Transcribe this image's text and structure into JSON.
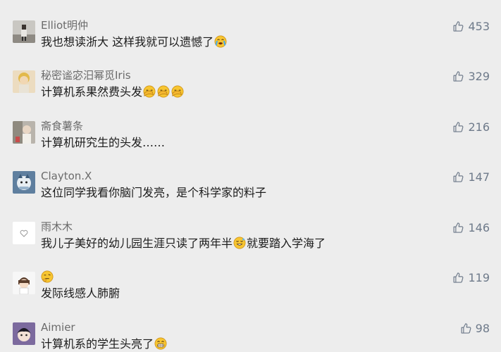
{
  "comments": [
    {
      "name": "Elliot明仲",
      "text": "我也想读浙大 这样我就可以遗憾了",
      "likes": "453"
    },
    {
      "name": "秘密谧宓汨幂觅Iris",
      "text": "计算机系果然费头发",
      "likes": "329"
    },
    {
      "name": "斋食薯条",
      "text": "计算机研究生的头发……",
      "likes": "216"
    },
    {
      "name": "Clayton.X",
      "text": "这位同学我看你脑门发亮，是个科学家的料子",
      "likes": "147"
    },
    {
      "name": "雨木木",
      "text": "我儿子美好的幼儿园生涯只读了两年半",
      "text2": "就要踏入学海了",
      "likes": "146"
    },
    {
      "name": "",
      "text": "发际线感人肺腑",
      "likes": "119"
    },
    {
      "name": "Aimier",
      "text": "计算机系的学生头亮了",
      "likes": "98"
    }
  ],
  "icons": {
    "like": "thumbs-up-icon",
    "crying": "loudly-crying-emoji",
    "facepalm": "facepalm-emoji",
    "awkward": "awkward-smile-emoji",
    "thinking": "thinking-emoji",
    "grin": "grin-emoji"
  },
  "colors": {
    "background": "#ededed",
    "name": "#6b6b6b",
    "text": "#1b1b1b",
    "like": "#6e7a8a"
  }
}
